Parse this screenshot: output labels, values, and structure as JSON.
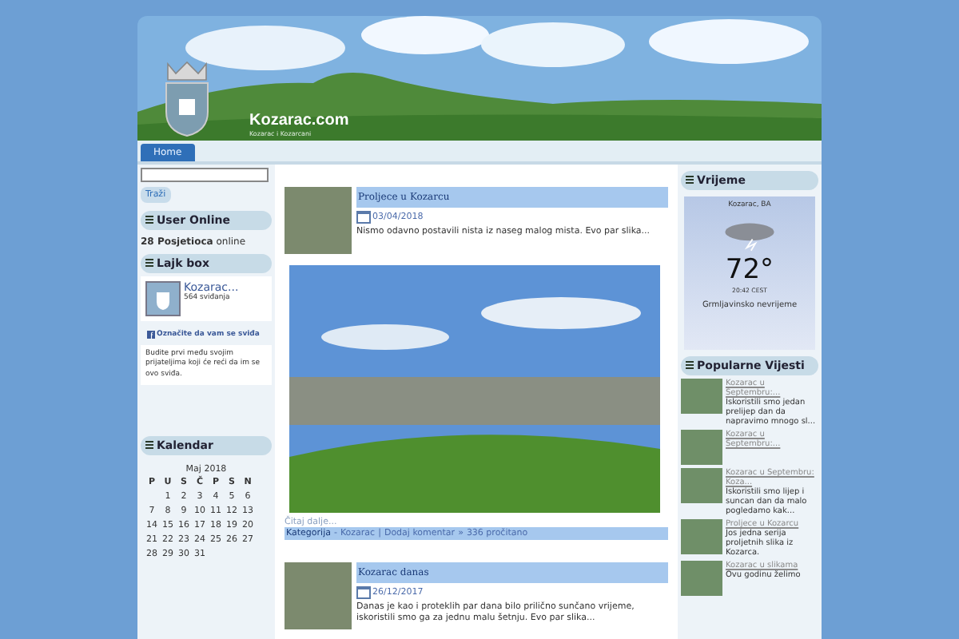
{
  "header": {
    "site_name": "Kozarac.com",
    "tagline": "Kozarac i Kozarcani"
  },
  "nav": [
    {
      "label": "Home",
      "selected": true
    }
  ],
  "search": {
    "button": "Traži"
  },
  "user_online": {
    "title": "User Online",
    "count": "28 Posjetioca",
    "suffix": "online"
  },
  "like_box": {
    "title": "Lajk box",
    "page_name": "Kozarac...",
    "likes": "564 sviđanja",
    "like_button": "Označite da vam se sviđa",
    "text": "Budite prvi među svojim prijateljima koji će reći da im se ovo sviđa."
  },
  "calendar": {
    "title": "Kalendar",
    "month": "Maj 2018",
    "weekdays": [
      "P",
      "U",
      "S",
      "Č",
      "P",
      "S",
      "N"
    ],
    "weeks": [
      [
        "1",
        "2",
        "3",
        "4",
        "5",
        "6"
      ],
      [
        "7",
        "8",
        "9",
        "10",
        "11",
        "12",
        "13"
      ],
      [
        "14",
        "15",
        "16",
        "17",
        "18",
        "19",
        "20"
      ],
      [
        "21",
        "22",
        "23",
        "24",
        "25",
        "26",
        "27"
      ],
      [
        "28",
        "29",
        "30",
        "31"
      ]
    ]
  },
  "posts": [
    {
      "title": "Proljece u Kozarcu",
      "date": "03/04/2018",
      "excerpt": "Nismo odavno postavili nista iz naseg malog mista. Evo par slika...",
      "read_more": "Čitaj dalje...",
      "category_label": "Kategorija",
      "category": "Kozarac",
      "comment": "Dodaj komentar",
      "views": "336 pročitano",
      "separators": [
        "-",
        "|",
        "»"
      ]
    },
    {
      "title": "Kozarac danas",
      "date": "26/12/2017",
      "excerpt": "Danas je kao i proteklih par dana bilo prilično sunčano vrijeme, iskoristili smo ga za jednu malu šetnju. Evo par slika..."
    }
  ],
  "weather": {
    "title": "Vrijeme",
    "location": "Kozarac, BA",
    "temperature": "72°",
    "time": "20:42 CEST",
    "condition": "Grmljavinsko nevrijeme"
  },
  "popular": {
    "title": "Popularne Vijesti",
    "items": [
      {
        "link": "Kozarac u Septembru:...",
        "text": "Iskoristili smo jedan prelijep dan da napravimo mnogo sl..."
      },
      {
        "link": "Kozarac u Septembru:..."
      },
      {
        "link": "Kozarac u Septembru: Koza...",
        "text": "Iskoristili smo lijep i suncan dan da malo pogledamo kak..."
      },
      {
        "link": "Proljece u Kozarcu",
        "text": "Jos jedna serija proljetnih slika iz Kozarca."
      },
      {
        "link": "Kozarac u slikama",
        "text": "Ovu godinu želimo"
      }
    ]
  }
}
